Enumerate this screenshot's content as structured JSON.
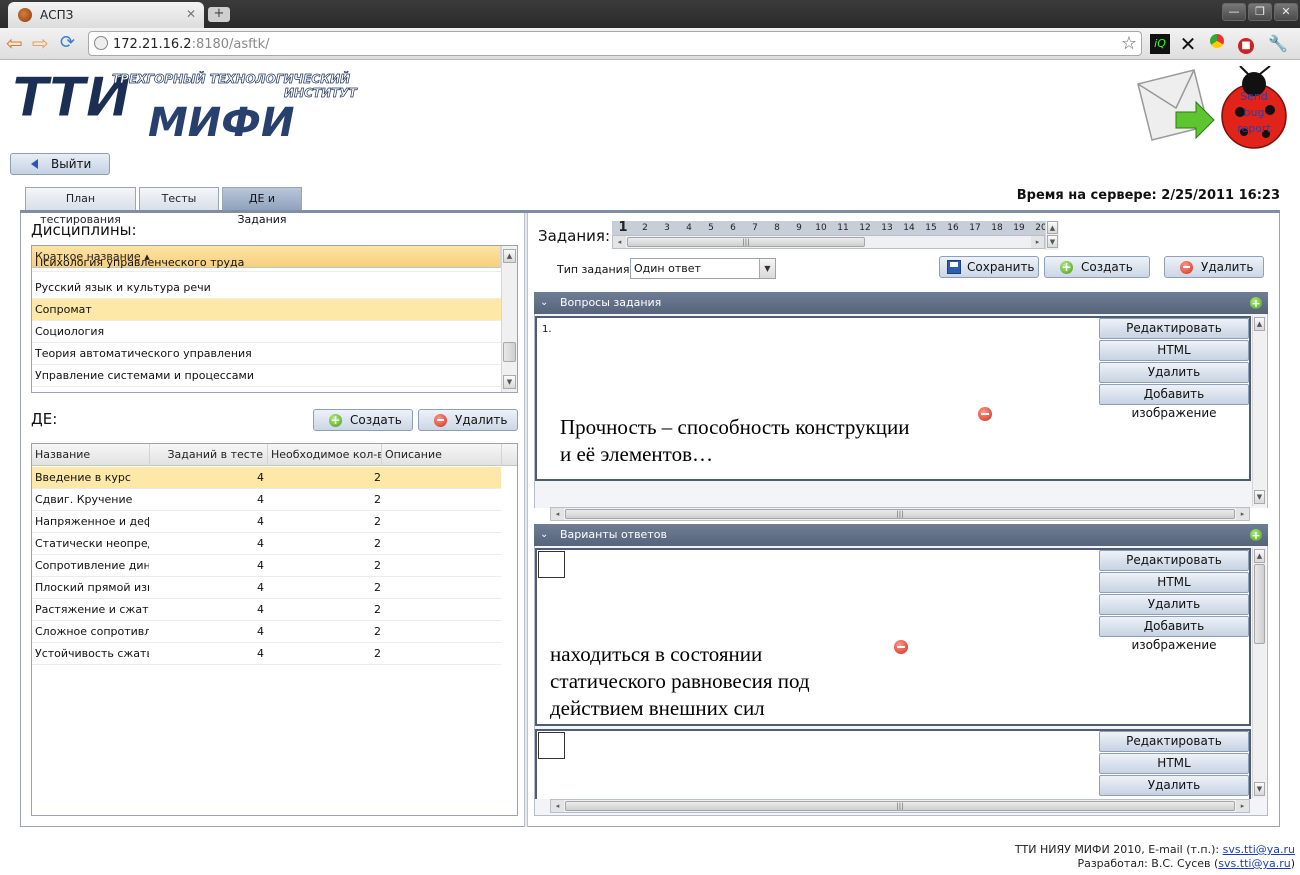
{
  "browser": {
    "tab_title": "АСПЗ",
    "url_host": "172.21.16.2",
    "url_rest": ":8180/asftk/"
  },
  "header": {
    "logo_line1": "ТРЕХГОРНЫЙ ТЕХНОЛОГИЧЕСКИЙ",
    "logo_line2": "ИНСТИТУТ",
    "logo_tti": "ТТИ",
    "logo_mifi": "МИФИ",
    "bug_text1": "Send",
    "bug_text2": "bug",
    "bug_text3": "report",
    "logout_label": "Выйти",
    "server_time": "Время на сервере: 2/25/2011 16:23"
  },
  "tabs": [
    {
      "label": "План тестирования"
    },
    {
      "label": "Тесты"
    },
    {
      "label": "ДЕ и Задания"
    }
  ],
  "disciplines": {
    "title": "Дисциплины:",
    "column": "Краткое название",
    "rows": [
      "Психология управленческого труда",
      "Русский язык и культура речи",
      "Сопромат",
      "Социология",
      "Теория автоматического управления",
      "Управление системами и процессами"
    ]
  },
  "de": {
    "title": "ДЕ:",
    "create_label": "Создать",
    "delete_label": "Удалить",
    "columns": [
      "Название",
      "Заданий в тесте",
      "Необходимое кол-во",
      "Описание"
    ],
    "rows": [
      [
        "Введение в курс",
        "4",
        "2",
        ""
      ],
      [
        "Сдвиг. Кручение",
        "4",
        "2",
        ""
      ],
      [
        "Напряженное и дефор",
        "4",
        "2",
        ""
      ],
      [
        "Статически неопредел",
        "4",
        "2",
        ""
      ],
      [
        "Сопротивление динам",
        "4",
        "2",
        ""
      ],
      [
        "Плоский прямой изгиб",
        "4",
        "2",
        ""
      ],
      [
        "Растяжение и сжатие",
        "4",
        "2",
        ""
      ],
      [
        "Сложное сопротивлен",
        "4",
        "2",
        ""
      ],
      [
        "Устойчивость сжатых",
        "4",
        "2",
        ""
      ]
    ]
  },
  "tasks": {
    "title": "Задания:",
    "numbers": [
      "1",
      "2",
      "3",
      "4",
      "5",
      "6",
      "7",
      "8",
      "9",
      "10",
      "11",
      "12",
      "13",
      "14",
      "15",
      "16",
      "17",
      "18",
      "19",
      "20"
    ],
    "type_label": "Тип задания :",
    "type_value": "Один ответ",
    "save_label": "Сохранить",
    "create_label": "Создать",
    "delete_label": "Удалить"
  },
  "questions": {
    "title": "Вопросы задания",
    "index": "1.",
    "text_line1": "Прочность – способность конструкции",
    "text_line2": "и её элементов…"
  },
  "answers": {
    "title": "Варианты ответов",
    "text_line1": "находиться в состоянии",
    "text_line2": "статического равновесия под",
    "text_line3": "действием внешних сил"
  },
  "side_buttons": {
    "edit": "Редактировать",
    "html": "HTML",
    "delete": "Удалить",
    "add_image": "Добавить изображение"
  },
  "footer": {
    "line1_prefix": "ТТИ НИЯУ МИФИ 2010, E-mail (т.п.):",
    "line1_email": "svs.tti@ya.ru",
    "line2_prefix": "Разработал: В.С. Сусев (",
    "line2_email": "svs.tti@ya.ru",
    "line2_suffix": ")"
  }
}
